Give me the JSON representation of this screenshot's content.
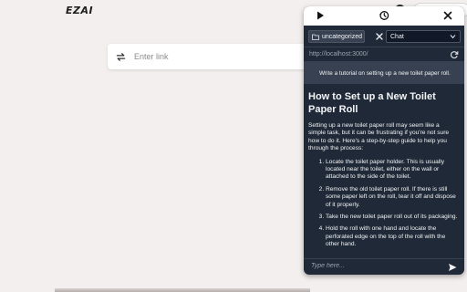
{
  "app": {
    "logo": "EZAI"
  },
  "link_bar": {
    "placeholder": "Enter link"
  },
  "top_right": {
    "button_label": "S"
  },
  "panel": {
    "folder_label": "uncategorized",
    "mode_select": "Chat",
    "url": "http://localhost:3000/",
    "user_message": "Write a tutorial on setting up a new toilet paper roll.",
    "answer": {
      "title": "How to Set up a New Toilet Paper Roll",
      "intro": "Setting up a new toilet paper roll may seem like a simple task, but it can be frustrating if you're not sure how to do it. Here's a step-by-step guide to help you through the process:",
      "steps": [
        "Locate the toilet paper holder. This is usually located near the toilet, either on the wall or attached to the side of the toilet.",
        "Remove the old toilet paper roll. If there is still some paper left on the roll, tear it off and dispose of it properly.",
        "Take the new toilet paper roll out of its packaging.",
        "Hold the roll with one hand and locate the perforated edge on the top of the roll with the other hand."
      ]
    },
    "composer_placeholder": "Type here...",
    "colors": {
      "panel_bg": "#1f2937",
      "message_bg": "#374151",
      "page_bg": "#f3efee"
    }
  }
}
